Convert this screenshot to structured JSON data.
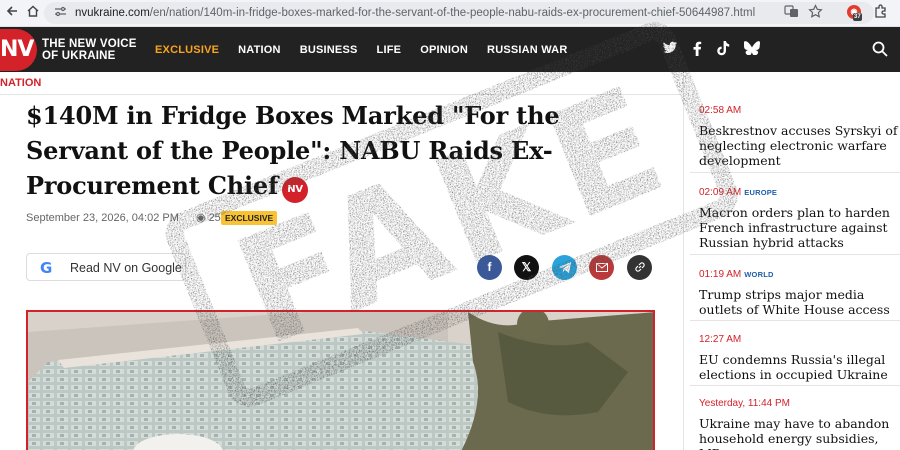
{
  "browser": {
    "url_host": "nvukraine.com",
    "url_path": "/en/nation/140m-in-fridge-boxes-marked-for-the-servant-of-the-people-nabu-raids-ex-procurement-chief-50644987.html",
    "extension_count": "37"
  },
  "site": {
    "logo_mark": "NV",
    "logo_line1": "THE NEW VOICE",
    "logo_line2": "OF UKRAINE",
    "nav": [
      "EXCLUSIVE",
      "NATION",
      "BUSINESS",
      "LIFE",
      "OPINION",
      "RUSSIAN WAR"
    ]
  },
  "section": "NATION",
  "article": {
    "title": "$140M in Fridge Boxes Marked \"For the Servant of the People\": NABU Raids Ex-Procurement Chief",
    "badge": "NV",
    "date": "September 23, 2026, 04:02 PM",
    "views": "2517",
    "tag": "EXCLUSIVE",
    "google_button": "Read NV on Google"
  },
  "sidebar": [
    {
      "time": "02:58 AM",
      "tag": "",
      "title": "Beskrestnov accuses Syrskyi of neglecting electronic warfare development"
    },
    {
      "time": "02:09 AM",
      "tag": "EUROPE",
      "title": "Macron orders plan to harden French infrastructure against Russian hybrid attacks"
    },
    {
      "time": "01:19 AM",
      "tag": "WORLD",
      "title": "Trump strips major media outlets of White House access"
    },
    {
      "time": "12:27 AM",
      "tag": "",
      "title": "EU condemns Russia's illegal elections in occupied Ukraine"
    },
    {
      "time": "Yesterday, 11:44 PM",
      "tag": "",
      "title": "Ukraine may have to abandon household energy subsidies, MP says"
    }
  ],
  "overlay": {
    "stamp_text": "FAKE",
    "stamp_color": "#4a4a4a"
  },
  "colors": {
    "brand_red": "#d3222a",
    "nav_bg": "#222222",
    "nav_active": "#f7a520",
    "exclusive_tag": "#f7c234"
  },
  "icons": [
    "back-arrow-icon",
    "reload-icon",
    "home-icon",
    "site-info-icon",
    "translate-icon",
    "star-icon",
    "extensions-icon",
    "twitter-icon",
    "facebook-icon",
    "tiktok-icon",
    "bluesky-icon",
    "search-icon",
    "eye-icon",
    "google-icon",
    "facebook-share-icon",
    "x-share-icon",
    "telegram-share-icon",
    "email-share-icon",
    "link-share-icon"
  ]
}
